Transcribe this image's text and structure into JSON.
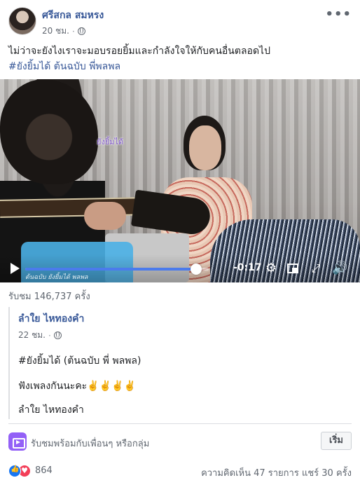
{
  "post": {
    "author": "ศรีสกล สมหรง",
    "time": "20 ชม.",
    "privacy_icon": "globe-icon",
    "caption_text": "ไม่ว่าจะยังไงเราจะมอบรอยยิ้มและกำลังใจให้กับคนอื่นตลอดไป",
    "hashtags": "#ยังยิ้มได้ ต้นฉบับ พี่พลพล"
  },
  "video": {
    "overlay_text": "ยังยิ้มได้",
    "title_text": "ต้นฉบับ ยังยิ้มได้ พลพล",
    "time_remaining": "-0:17",
    "progress": 0.93,
    "accent_color": "#4b7bec"
  },
  "views": "รับชม 146,737 ครั้ง",
  "shared": {
    "author": "ลำใย ไหทองคำ",
    "time": "22 ชม.",
    "line1": "#ยังยิ้มได้ (ต้นฉบับ พี่ พลพล)",
    "line2": "ฟังเพลงกันนะคะ✌️✌️✌️✌️",
    "line3": "ลำใย ไหทองคำ"
  },
  "watch_party": {
    "text": "รับชมพร้อมกับเพื่อนๆ หรือกลุ่ม",
    "button": "เริ่ม",
    "icon_color": "#9360f7"
  },
  "footer": {
    "reaction_count": "864",
    "comments": "ความคิดเห็น 47 รายการ",
    "shares": "แชร์ 30 ครั้ง"
  }
}
